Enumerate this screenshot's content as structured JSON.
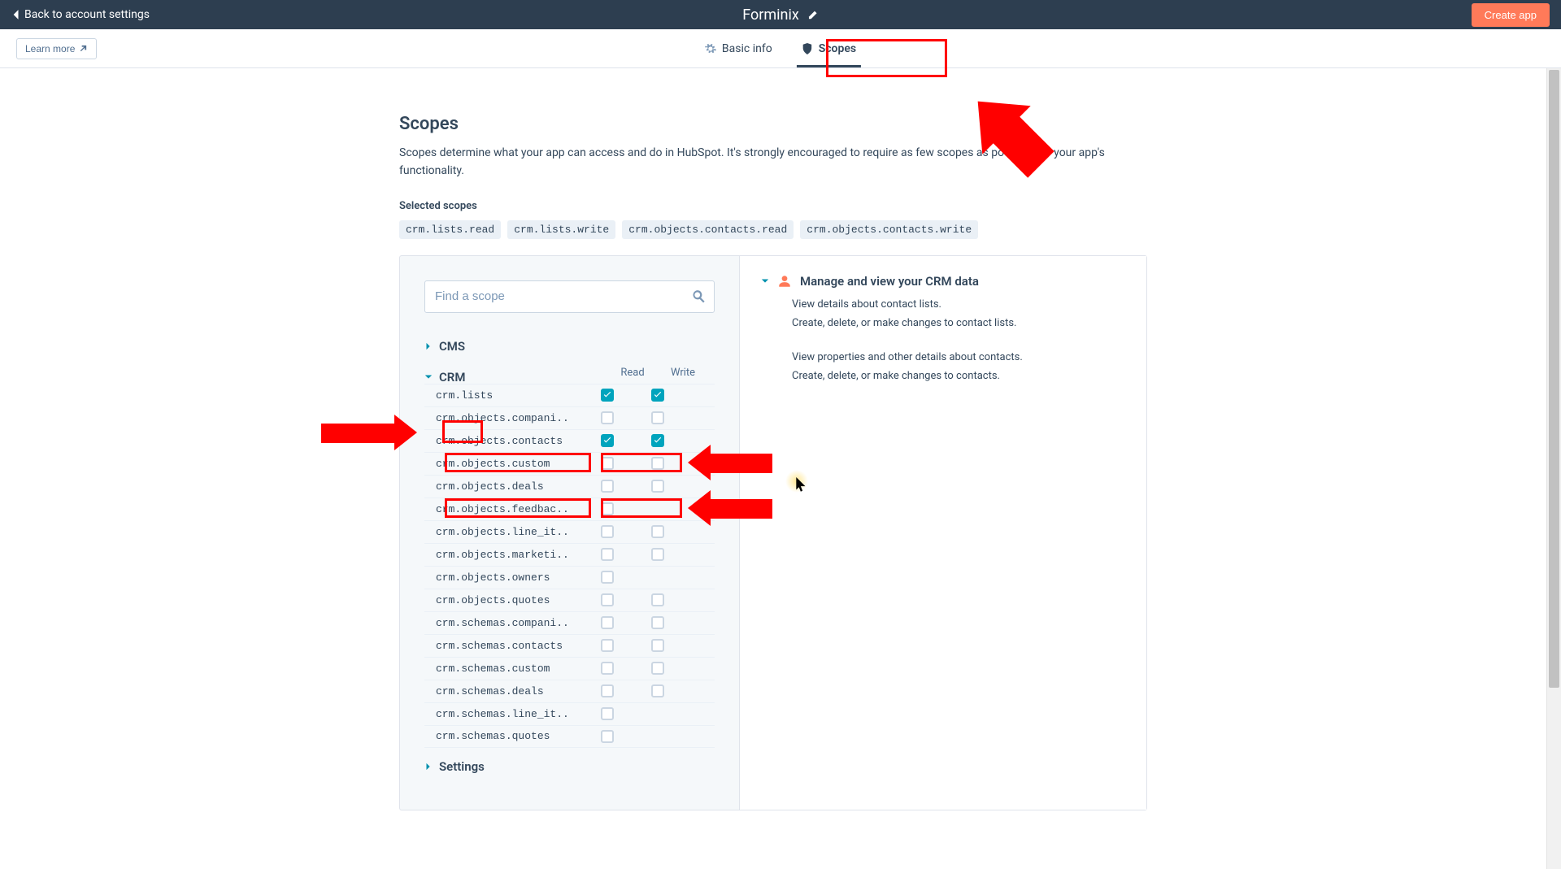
{
  "header": {
    "back_label": "Back to account settings",
    "app_name": "Forminix",
    "create_label": "Create app"
  },
  "subnav": {
    "learn_more_label": "Learn more",
    "tabs": [
      {
        "label": "Basic info",
        "active": false
      },
      {
        "label": "Scopes",
        "active": true
      }
    ]
  },
  "page": {
    "title": "Scopes",
    "description": "Scopes determine what your app can access and do in HubSpot. It's strongly encouraged to require as few scopes as possible for your app's functionality.",
    "selected_label": "Selected scopes",
    "selected_scopes": [
      "crm.lists.read",
      "crm.lists.write",
      "crm.objects.contacts.read",
      "crm.objects.contacts.write"
    ]
  },
  "search": {
    "placeholder": "Find a scope"
  },
  "columns": {
    "read": "Read",
    "write": "Write"
  },
  "categories": [
    {
      "name": "CMS",
      "open": false
    },
    {
      "name": "CRM",
      "open": true,
      "scopes": [
        {
          "name": "crm.lists",
          "read": true,
          "write": true
        },
        {
          "name": "crm.objects.compani..",
          "read": false,
          "write": false
        },
        {
          "name": "crm.objects.contacts",
          "read": true,
          "write": true
        },
        {
          "name": "crm.objects.custom",
          "read": false,
          "write": false
        },
        {
          "name": "crm.objects.deals",
          "read": false,
          "write": false
        },
        {
          "name": "crm.objects.feedbac..",
          "read": false,
          "write": null
        },
        {
          "name": "crm.objects.line_it..",
          "read": false,
          "write": false
        },
        {
          "name": "crm.objects.marketi..",
          "read": false,
          "write": false
        },
        {
          "name": "crm.objects.owners",
          "read": false,
          "write": null
        },
        {
          "name": "crm.objects.quotes",
          "read": false,
          "write": false
        },
        {
          "name": "crm.schemas.compani..",
          "read": false,
          "write": false
        },
        {
          "name": "crm.schemas.contacts",
          "read": false,
          "write": false
        },
        {
          "name": "crm.schemas.custom",
          "read": false,
          "write": false
        },
        {
          "name": "crm.schemas.deals",
          "read": false,
          "write": false
        },
        {
          "name": "crm.schemas.line_it..",
          "read": false,
          "write": null
        },
        {
          "name": "crm.schemas.quotes",
          "read": false,
          "write": null
        }
      ]
    },
    {
      "name": "Settings",
      "open": false
    }
  ],
  "detail": {
    "title": "Manage and view your CRM data",
    "lines": [
      "View details about contact lists.",
      "Create, delete, or make changes to contact lists.",
      "",
      "View properties and other details about contacts.",
      "Create, delete, or make changes to contacts."
    ]
  }
}
